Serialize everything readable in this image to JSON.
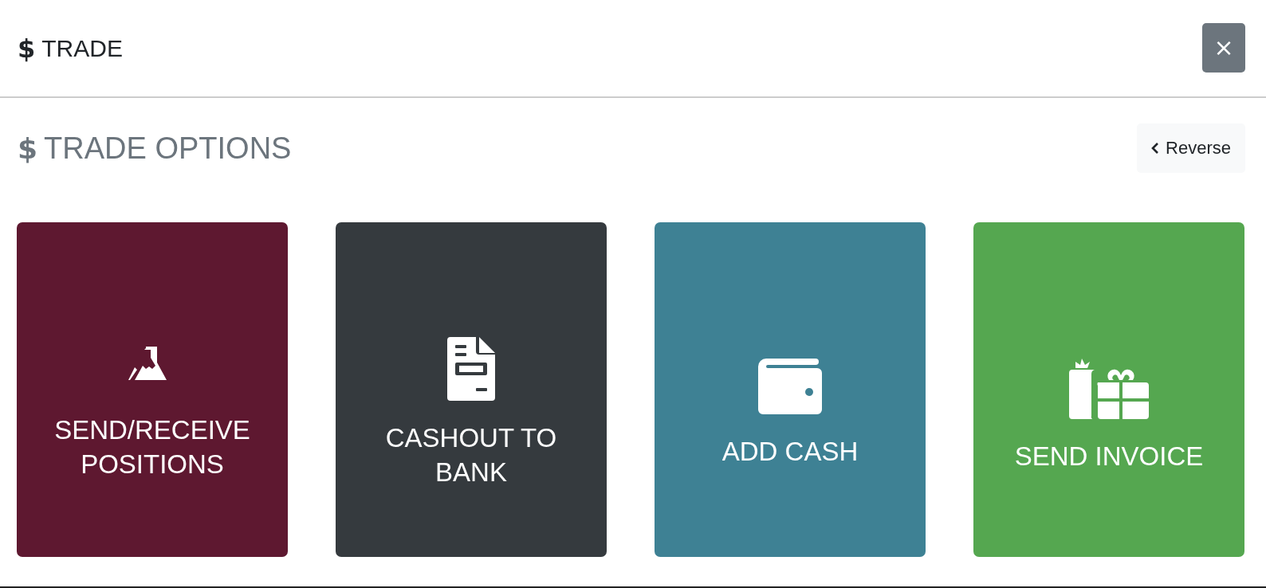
{
  "header": {
    "icon": "$",
    "title": "TRADE",
    "close": "×"
  },
  "section": {
    "icon": "$",
    "title": "TRADE OPTIONS",
    "reverse_button": "Reverse"
  },
  "options": [
    {
      "kind": "positions",
      "label": "SEND/RECEIVE POSITIONS",
      "color": "#5e1830"
    },
    {
      "kind": "cashout",
      "label": "CASHOUT TO BANK",
      "color": "#353a3e"
    },
    {
      "kind": "addcash",
      "label": "ADD CASH",
      "color": "#3e8194"
    },
    {
      "kind": "invoice",
      "label": "SEND INVOICE",
      "color": "#55a750"
    }
  ]
}
